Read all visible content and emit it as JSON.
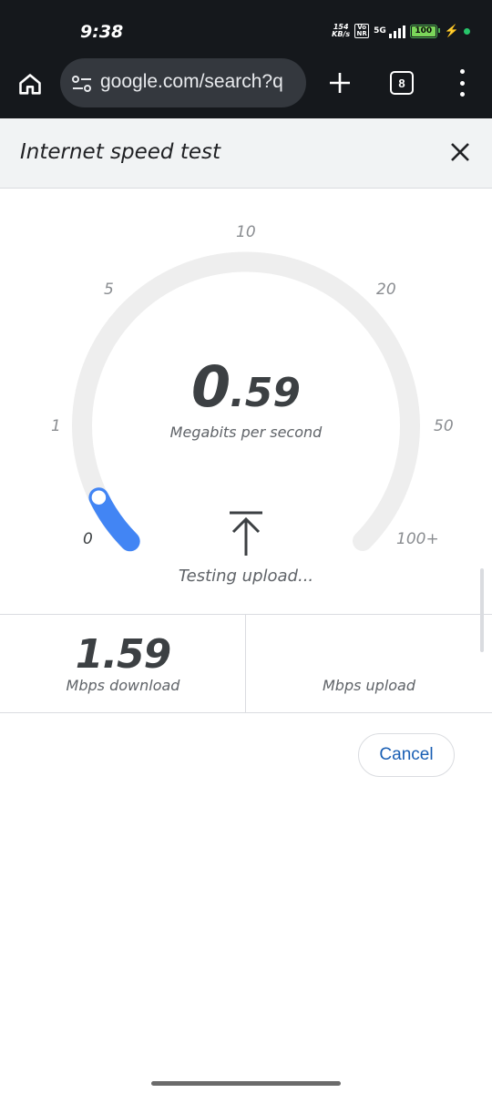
{
  "status_bar": {
    "time": "9:38",
    "net_speed_value": "154",
    "net_speed_unit": "KB/s",
    "volte_top": "Vo",
    "volte_bottom": "NR",
    "network": "5G",
    "battery": "100"
  },
  "browser": {
    "url": "google.com/search?q",
    "tab_count": "8"
  },
  "speed_test": {
    "title": "Internet speed test",
    "gauge_ticks": [
      "0",
      "1",
      "5",
      "10",
      "20",
      "50",
      "100+"
    ],
    "current_speed_int": "0",
    "current_speed_dec": ".59",
    "current_speed_units": "Megabits per second",
    "status": "Testing upload...",
    "download_value": "1.59",
    "download_label": "Mbps download",
    "upload_value": "",
    "upload_label": "Mbps upload",
    "cancel_label": "Cancel",
    "gauge_fill_fraction": 0.07
  },
  "colors": {
    "accent": "#4285f4",
    "track": "#eeeeee",
    "cancel_text": "#1a5fb4",
    "dark_bar": "#15181c"
  }
}
